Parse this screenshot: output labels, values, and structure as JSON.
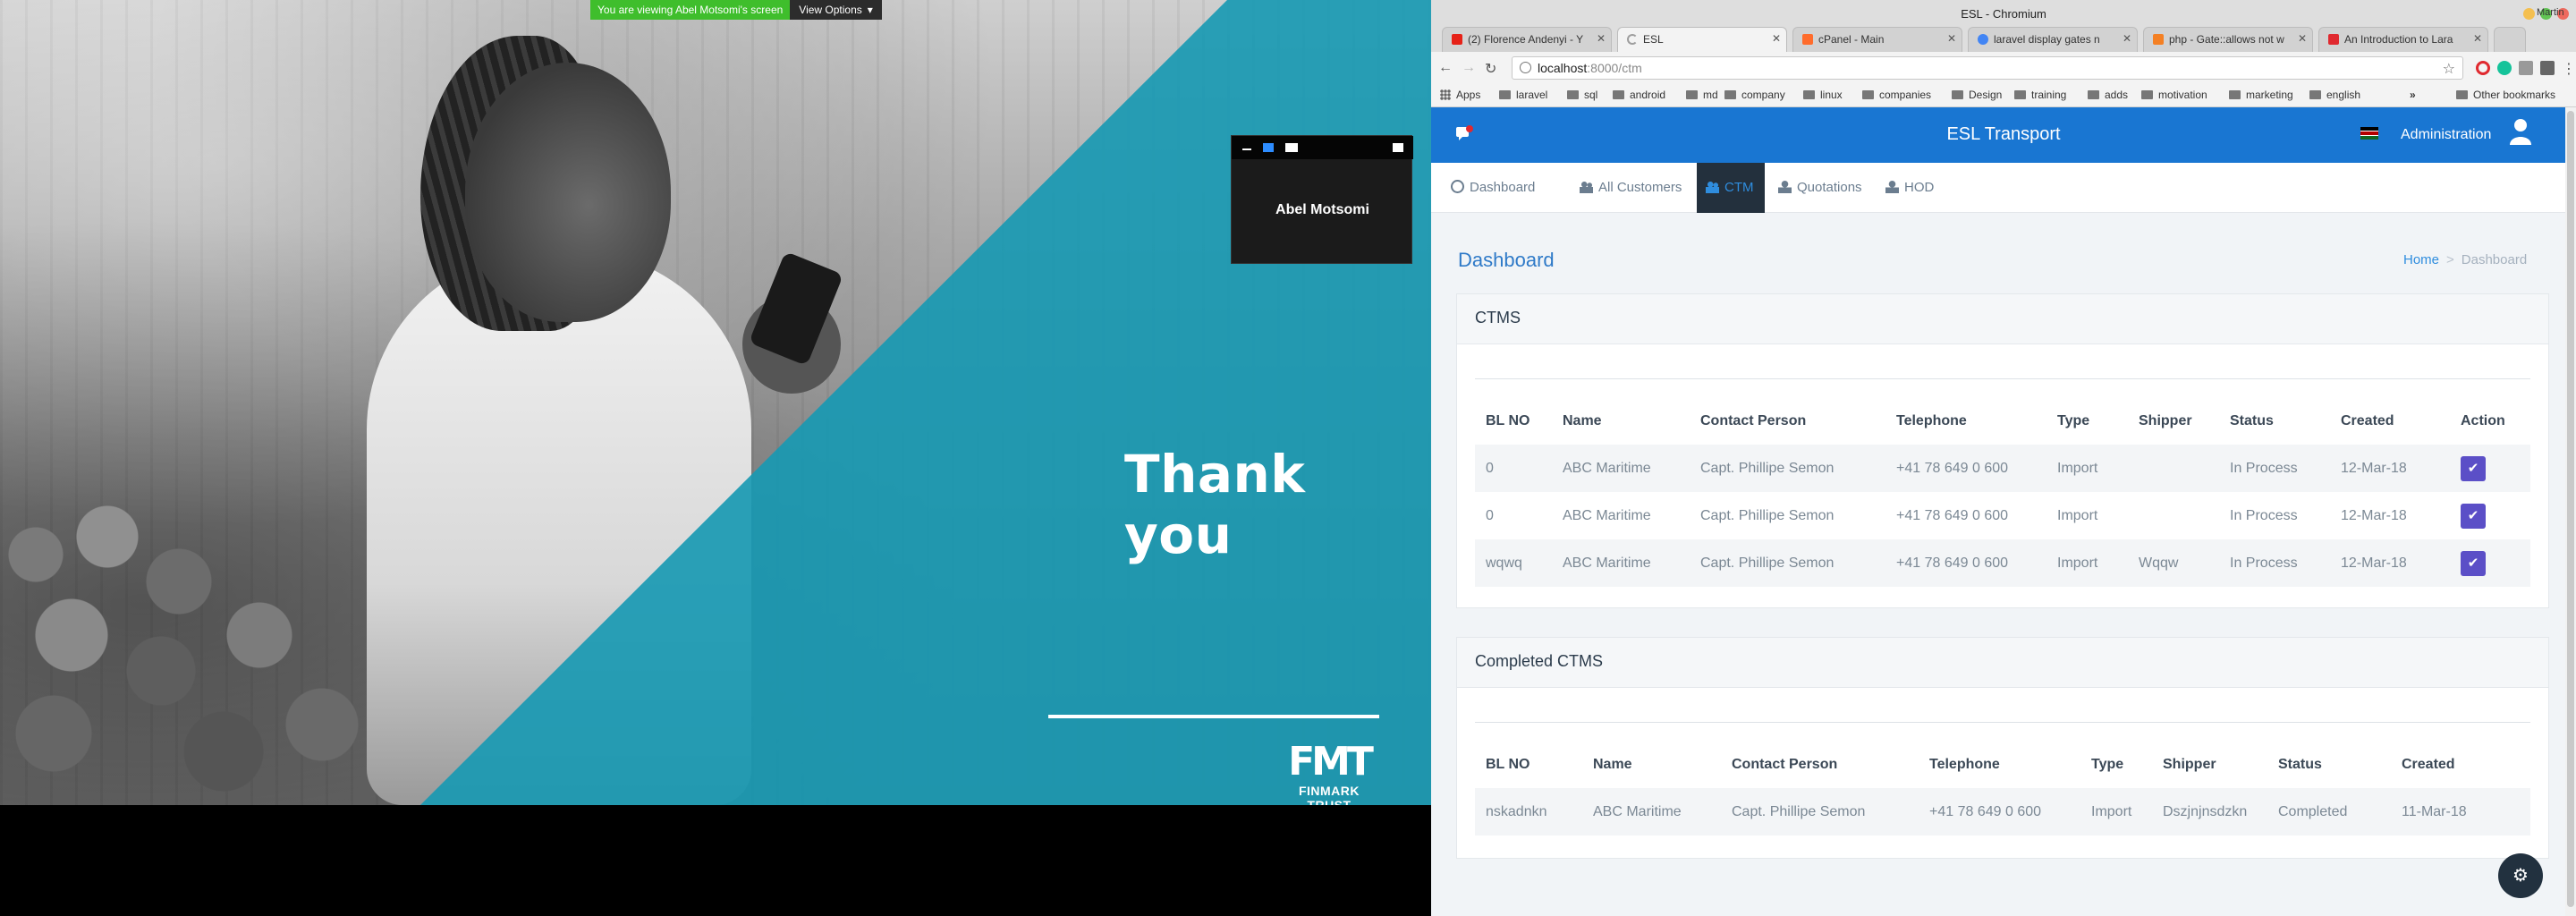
{
  "share": {
    "banner_text": "You are viewing Abel Motsomi's screen",
    "options_label": "View Options",
    "participant_name": "Abel Motsomi",
    "slide": {
      "headline": "Thank you",
      "logo_mark": "FMT",
      "logo_text": "FINMARK TRUST",
      "accent_color": "#1aa3bd"
    }
  },
  "browser": {
    "window_title": "ESL - Chromium",
    "tabs": [
      {
        "label": "(2) Florence Andenyi - Y",
        "icon": "youtube-icon",
        "color": "#e62117"
      },
      {
        "label": "ESL",
        "icon": "loading-icon",
        "color": "#9e9e9e"
      },
      {
        "label": "cPanel - Main",
        "icon": "cpanel-icon",
        "color": "#ff6c2c"
      },
      {
        "label": "laravel display gates n",
        "icon": "google-icon",
        "color": "#4285f4"
      },
      {
        "label": "php - Gate::allows not w",
        "icon": "stackoverflow-icon",
        "color": "#f48024"
      },
      {
        "label": "An Introduction to Lara",
        "icon": "n-icon",
        "color": "#e0292f"
      }
    ],
    "profile_label": "Martin",
    "url_host": "localhost",
    "url_path": ":8000/ctm",
    "bookmarks": [
      "Apps",
      "laravel",
      "sql",
      "android",
      "md",
      "company",
      "linux",
      "companies",
      "Design",
      "training",
      "adds",
      "motivation",
      "marketing",
      "english"
    ],
    "other_bookmarks": "Other bookmarks",
    "more_bookmarks": "»"
  },
  "app": {
    "brand": "ESL Transport",
    "admin_label": "Administration",
    "nav": [
      {
        "label": "Dashboard",
        "icon": "dashboard-icon"
      },
      {
        "label": "All Customers",
        "icon": "users-icon"
      },
      {
        "label": "CTM",
        "icon": "users-icon"
      },
      {
        "label": "Quotations",
        "icon": "user-icon"
      },
      {
        "label": "HOD",
        "icon": "user-icon"
      }
    ],
    "page_title": "Dashboard",
    "breadcrumb": {
      "home": "Home",
      "sep": ">",
      "current": "Dashboard"
    },
    "ctms": {
      "title": "CTMS",
      "columns": [
        "BL NO",
        "Name",
        "Contact Person",
        "Telephone",
        "Type",
        "Shipper",
        "Status",
        "Created",
        "Action"
      ],
      "rows": [
        [
          "0",
          "ABC Maritime",
          "Capt. Phillipe Semon",
          "+41 78 649 0 600",
          "Import",
          "",
          "In Process",
          "12-Mar-18"
        ],
        [
          "0",
          "ABC Maritime",
          "Capt. Phillipe Semon",
          "+41 78 649 0 600",
          "Import",
          "",
          "In Process",
          "12-Mar-18"
        ],
        [
          "wqwq",
          "ABC Maritime",
          "Capt. Phillipe Semon",
          "+41 78 649 0 600",
          "Import",
          "Wqqw",
          "In Process",
          "12-Mar-18"
        ]
      ],
      "action_icon": "check-icon"
    },
    "completed": {
      "title": "Completed CTMS",
      "columns": [
        "BL NO",
        "Name",
        "Contact Person",
        "Telephone",
        "Type",
        "Shipper",
        "Status",
        "Created"
      ],
      "rows": [
        [
          "nskadnkn",
          "ABC Maritime",
          "Capt. Phillipe Semon",
          "+41 78 649 0 600",
          "Import",
          "Dszjnjnsdzkn",
          "Completed",
          "11-Mar-18"
        ]
      ]
    },
    "primary_color": "#1976d2",
    "action_color": "#5b4fc7"
  }
}
